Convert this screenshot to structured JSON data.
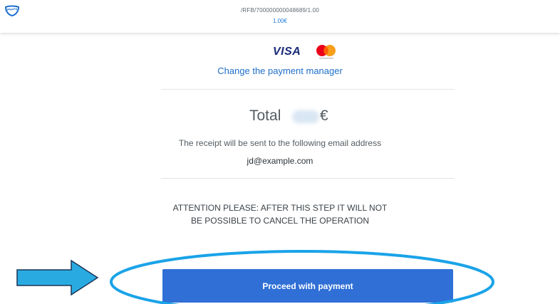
{
  "header": {
    "logo_icon": "pagopa-logo-icon",
    "reference": "/RFB/700000000048689/1.00",
    "amount": "1.00€"
  },
  "payment_method": {
    "visa_label": "VISA",
    "mastercard_icon": "mastercard-logo-icon",
    "change_link": "Change the payment manager"
  },
  "summary": {
    "total_label": "Total",
    "total_currency": "€",
    "receipt_text": "The receipt will be sent to the following email address",
    "email": "jd@example.com"
  },
  "warning": {
    "line1": "ATTENTION PLEASE: AFTER THIS STEP IT WILL NOT",
    "line2": "BE POSSIBLE TO CANCEL THE OPERATION"
  },
  "actions": {
    "proceed_label": "Proceed with payment"
  },
  "annotations": {
    "arrow_icon": "right-arrow-icon",
    "highlight_color": "#1aa3e8",
    "arrow_color": "#29abe2"
  },
  "colors": {
    "primary": "#2f6fd6",
    "link": "#1f6fc9"
  }
}
